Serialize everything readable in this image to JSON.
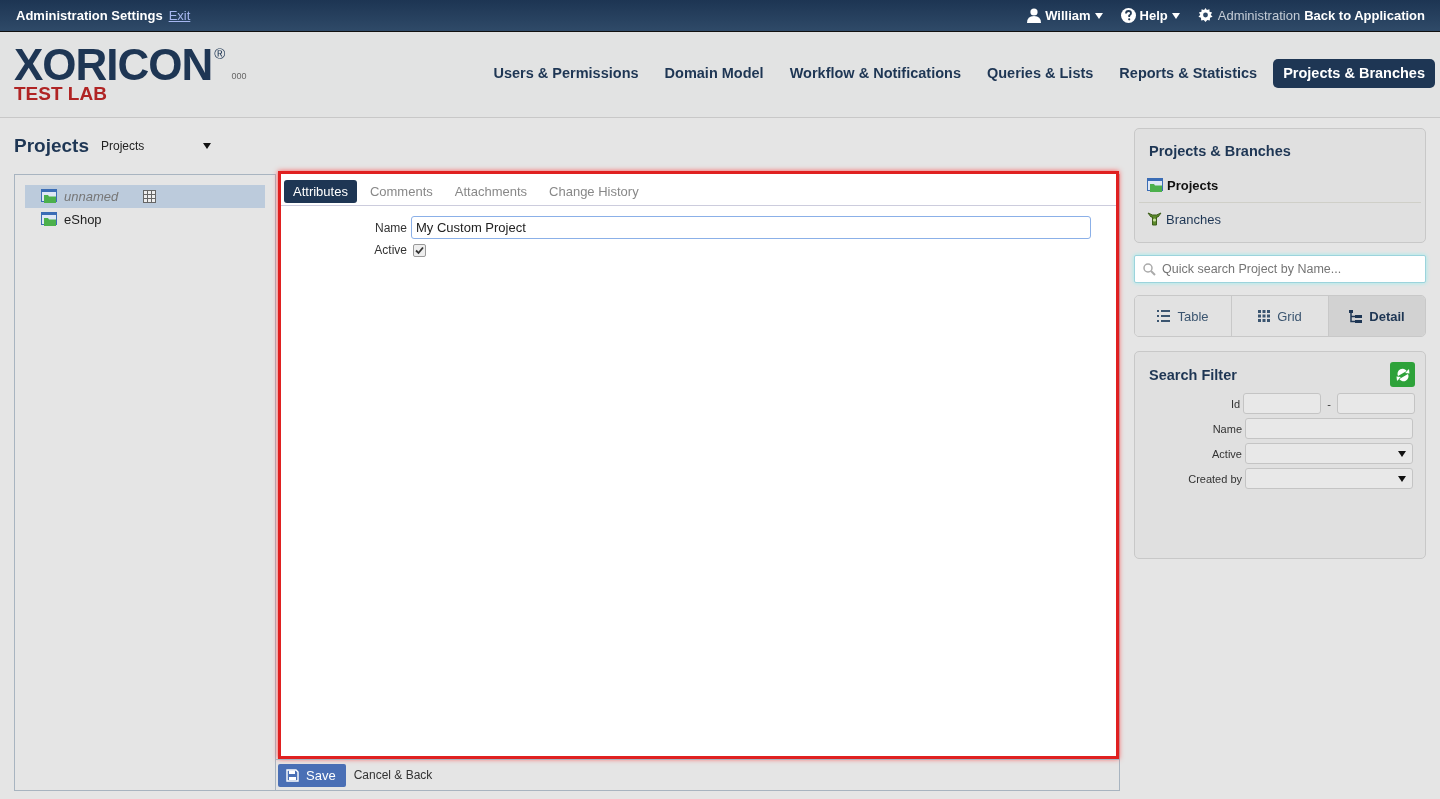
{
  "topbar": {
    "title": "Administration Settings",
    "exit": "Exit",
    "user": "William",
    "help": "Help",
    "admin": "Administration",
    "back": "Back to Application"
  },
  "logo": {
    "name": "XORICON",
    "mark": "®",
    "subtitle": "TEST LAB",
    "version": "000"
  },
  "nav": [
    {
      "label": "Users & Permissions",
      "selected": false
    },
    {
      "label": "Domain Model",
      "selected": false
    },
    {
      "label": "Workflow & Notifications",
      "selected": false
    },
    {
      "label": "Queries & Lists",
      "selected": false
    },
    {
      "label": "Reports & Statistics",
      "selected": false
    },
    {
      "label": "Projects & Branches",
      "selected": true
    }
  ],
  "projects": {
    "title": "Projects",
    "select_value": "Projects"
  },
  "tree": [
    {
      "label": "unnamed",
      "selected": true,
      "unsaved": true
    },
    {
      "label": "eShop",
      "selected": false,
      "unsaved": false
    }
  ],
  "tabs": [
    {
      "label": "Attributes",
      "selected": true
    },
    {
      "label": "Comments",
      "selected": false
    },
    {
      "label": "Attachments",
      "selected": false
    },
    {
      "label": "Change History",
      "selected": false
    }
  ],
  "form": {
    "name_label": "Name",
    "name_value": "My Custom Project",
    "active_label": "Active",
    "active_checked": true
  },
  "footer": {
    "save": "Save",
    "cancel": "Cancel & Back"
  },
  "sidebar": {
    "title": "Projects & Branches",
    "items": [
      {
        "label": "Projects",
        "selected": true,
        "kind": "project"
      },
      {
        "label": "Branches",
        "selected": false,
        "kind": "branch"
      }
    ],
    "search_placeholder": "Quick search Project by Name...",
    "views": [
      {
        "label": "Table",
        "selected": false,
        "kind": "list"
      },
      {
        "label": "Grid",
        "selected": false,
        "kind": "grid"
      },
      {
        "label": "Detail",
        "selected": true,
        "kind": "detail"
      }
    ],
    "filter": {
      "title": "Search Filter",
      "fields": [
        {
          "label": "Id",
          "kind": "range",
          "separator": "-"
        },
        {
          "label": "Name",
          "kind": "text"
        },
        {
          "label": "Active",
          "kind": "select"
        },
        {
          "label": "Created by",
          "kind": "select"
        }
      ]
    }
  }
}
